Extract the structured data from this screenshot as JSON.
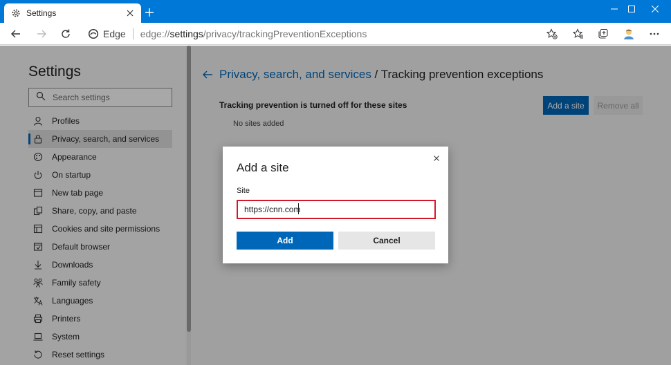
{
  "window": {
    "tab_title": "Settings",
    "new_tab_label": "+"
  },
  "addressbar": {
    "site_name": "Edge",
    "url_scheme": "edge://",
    "url_host": "settings",
    "url_path": "/privacy/trackingPreventionExceptions"
  },
  "sidebar": {
    "title": "Settings",
    "search_placeholder": "Search settings",
    "items": [
      {
        "label": "Profiles",
        "icon": "profile-icon"
      },
      {
        "label": "Privacy, search, and services",
        "icon": "lock-icon"
      },
      {
        "label": "Appearance",
        "icon": "appearance-icon"
      },
      {
        "label": "On startup",
        "icon": "power-icon"
      },
      {
        "label": "New tab page",
        "icon": "new-tab-icon"
      },
      {
        "label": "Share, copy, and paste",
        "icon": "share-icon"
      },
      {
        "label": "Cookies and site permissions",
        "icon": "cookie-icon"
      },
      {
        "label": "Default browser",
        "icon": "browser-icon"
      },
      {
        "label": "Downloads",
        "icon": "download-icon"
      },
      {
        "label": "Family safety",
        "icon": "family-icon"
      },
      {
        "label": "Languages",
        "icon": "language-icon"
      },
      {
        "label": "Printers",
        "icon": "printer-icon"
      },
      {
        "label": "System",
        "icon": "laptop-icon"
      },
      {
        "label": "Reset settings",
        "icon": "reset-icon"
      }
    ]
  },
  "content": {
    "breadcrumb_link": "Privacy, search, and services",
    "breadcrumb_sep": " / ",
    "breadcrumb_current": "Tracking prevention exceptions",
    "heading": "Tracking prevention is turned off for these sites",
    "empty_text": "No sites added",
    "add_site_label": "Add a site",
    "remove_all_label": "Remove all"
  },
  "dialog": {
    "title": "Add a site",
    "field_label": "Site",
    "field_value": "https://cnn.com",
    "add_label": "Add",
    "cancel_label": "Cancel"
  },
  "colors": {
    "titlebar": "#0078d7",
    "accent": "#0067b8",
    "input_highlight": "#d3182a"
  }
}
